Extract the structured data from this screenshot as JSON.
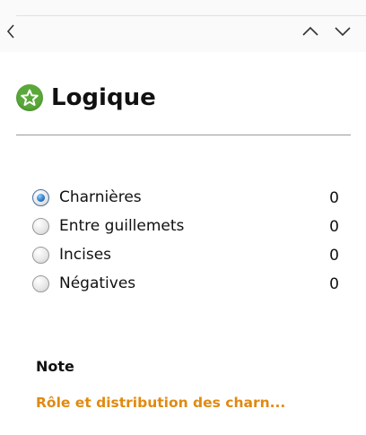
{
  "nav": {
    "back_icon": "chevron-left-icon",
    "up_icon": "chevron-up-icon",
    "down_icon": "chevron-down-icon"
  },
  "header": {
    "icon": "star-badge-icon",
    "title": "Logique"
  },
  "options": [
    {
      "label": "Charnières",
      "count": "0",
      "selected": true
    },
    {
      "label": "Entre guillemets",
      "count": "0",
      "selected": false
    },
    {
      "label": "Incises",
      "count": "0",
      "selected": false
    },
    {
      "label": "Négatives",
      "count": "0",
      "selected": false
    }
  ],
  "note": {
    "label": "Note",
    "link_text": "Rôle et distribution des charn..."
  },
  "colors": {
    "accent_link": "#e08a10",
    "star_badge": "#5aa83a",
    "radio_selected": "#2f7fd0"
  }
}
